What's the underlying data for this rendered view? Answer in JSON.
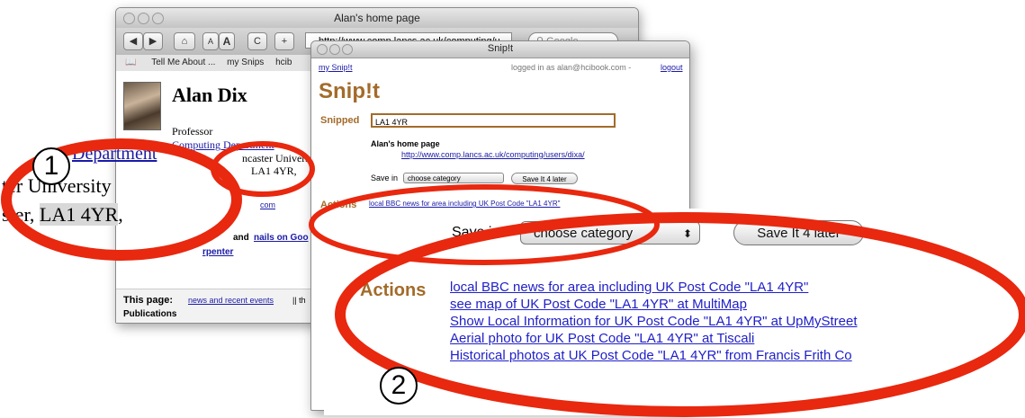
{
  "browser": {
    "title": "Alan's home page",
    "url": "http://www.comp.lancs.ac.uk/computing/u",
    "search_placeholder": "Google",
    "toolbar": {
      "back": "◀",
      "forward": "▶",
      "home": "⌂",
      "font_small": "A",
      "font_large": "A",
      "reload": "C",
      "add": "+"
    },
    "bookmarks": [
      "Tell Me About ...",
      "my Snips",
      "hcib"
    ],
    "page": {
      "name": "Alan Dix",
      "role": "Professor",
      "dept_link": "Computing Department",
      "university": "ncaster University",
      "postcode_line": "LA1 4YR,",
      "com_fragment": "com",
      "and_text": "and",
      "nails_link": "nails on Goo",
      "carpenter_link": "rpenter",
      "footer_label": "This page:",
      "footer_link": "news and recent events",
      "footer_sep": "|| th",
      "pub_fragment": "Publications"
    }
  },
  "snipit": {
    "title": "Snip!t",
    "my_snipit": "my Snip!t",
    "logged_in": "logged in as alan@hcibook.com -",
    "logout": "logout",
    "logo": "Snip!t",
    "snipped_label": "Snipped",
    "snipped_value": "LA1 4YR",
    "page_title": "Alan's home page",
    "page_url": "http://www.comp.lancs.ac.uk/computing/users/dixa/",
    "save_in_label": "Save in",
    "category_placeholder": "choose category",
    "save_button": "Save It 4 later",
    "actions_label": "Actions",
    "actions": [
      "local BBC news for area including UK Post Code \"LA1 4YR\"",
      "see map of UK Post Code \"LA1 4YR\" at MultiMap",
      "Show Local Information for UK Post Code \"LA1 4YR\" at UpMyStreet",
      "Aerial photo for UK Post Code \"LA1 4YR\" at Tiscali",
      "Historical photos at UK Post Code \"LA1 4YR\" from Francis Frith Co"
    ]
  },
  "zoom_left": {
    "line1": "Department",
    "line2": "ter University",
    "line3_prefix": "ster, ",
    "line3_highlight": "LA1 4YR",
    "line3_suffix": ","
  },
  "callouts": {
    "one": "1",
    "two": "2"
  },
  "colors": {
    "annotation_red": "#e8280f",
    "snipit_brown": "#a36b2a",
    "link_blue": "#1a1aa6"
  }
}
